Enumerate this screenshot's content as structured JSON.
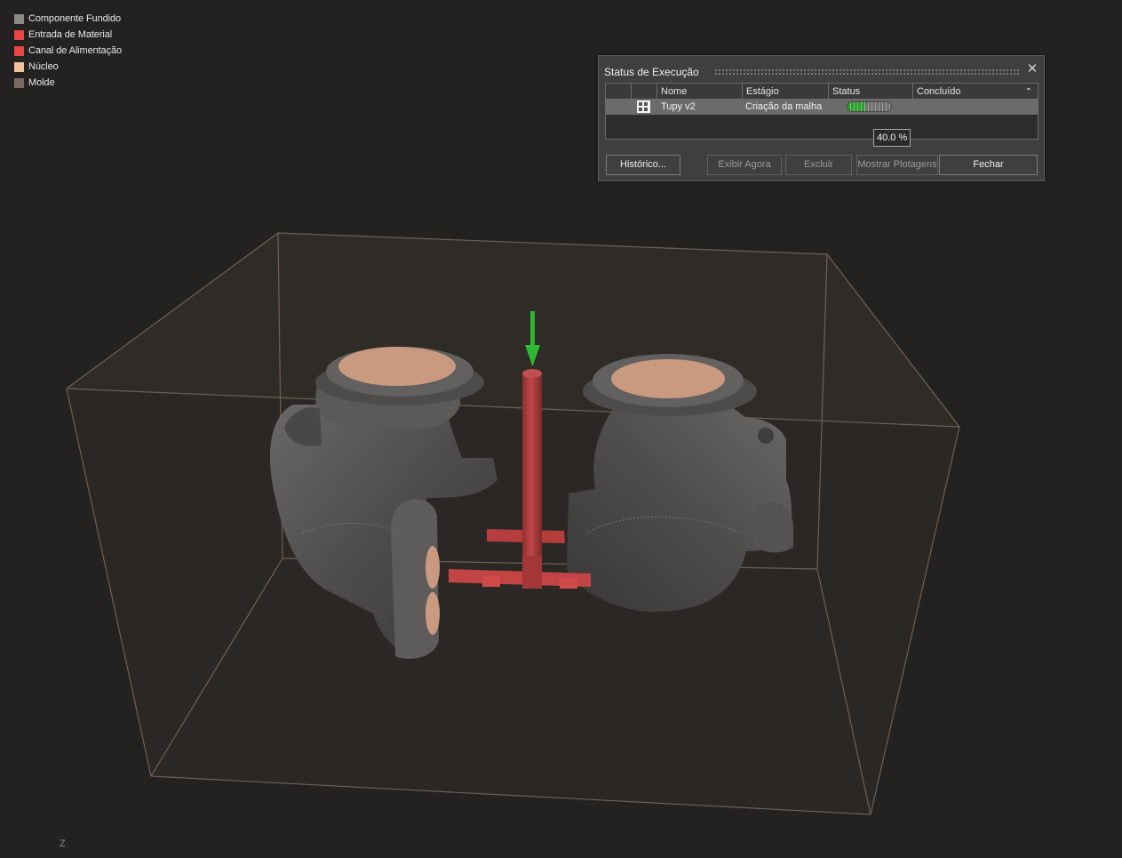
{
  "legend": [
    {
      "label": "Componente Fundido",
      "color": "#8a8a8a"
    },
    {
      "label": "Entrada de Material",
      "color": "#e84545"
    },
    {
      "label": "Canal de Alimentação",
      "color": "#e84545"
    },
    {
      "label": "Núcleo",
      "color": "#f3c29f"
    },
    {
      "label": "Molde",
      "color": "#7b6a63"
    }
  ],
  "axis_label": "Z",
  "dialog": {
    "title": "Status de Execução",
    "columns": [
      "Nome",
      "Estágio",
      "Status",
      "Concluído"
    ],
    "rows": [
      {
        "name": "Tupy v2",
        "stage": "Criação da malha",
        "progress": 0.4,
        "icon": "study-icon"
      }
    ],
    "progress_tooltip": "40.0 %",
    "buttons": {
      "history": "Histórico...",
      "show_now": "Exibir Agora",
      "delete": "Excluir",
      "show_plots": "Mostrar Plotagens",
      "close": "Fechar"
    }
  },
  "colors": {
    "background": "#232221",
    "casting": "#5a5856",
    "core": "#c99a80",
    "runner": "#c84646",
    "mold_box": "#6f6056",
    "arrow": "#2fb82f"
  }
}
